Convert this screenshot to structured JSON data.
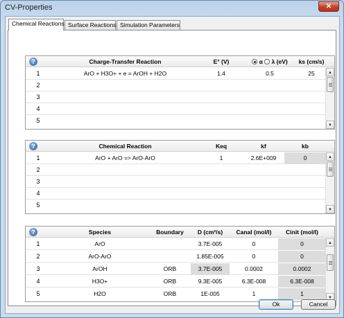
{
  "window": {
    "title": "CV-Properties",
    "close_glyph": "✕"
  },
  "tabs": [
    {
      "label": "Chemical Reactions",
      "active": true
    },
    {
      "label": "Surface Reactions",
      "active": false
    },
    {
      "label": "Simulation Parameters",
      "active": false
    }
  ],
  "charge_transfer": {
    "headers": {
      "reaction": "Charge-Transfer Reaction",
      "e0": "E° (V)",
      "alpha": "α",
      "lambda": "λ (eV)",
      "ks": "ks (cm/s)"
    },
    "selected_param": "alpha",
    "rows": [
      {
        "num": "1",
        "reaction": "ArO + H3O+ + e = ArOH + H2O",
        "e0": "1.4",
        "param": "0.5",
        "ks": "25"
      },
      {
        "num": "2",
        "reaction": "",
        "e0": "",
        "param": "",
        "ks": ""
      },
      {
        "num": "3",
        "reaction": "",
        "e0": "",
        "param": "",
        "ks": ""
      },
      {
        "num": "4",
        "reaction": "",
        "e0": "",
        "param": "",
        "ks": ""
      },
      {
        "num": "5",
        "reaction": "",
        "e0": "",
        "param": "",
        "ks": ""
      }
    ]
  },
  "chemical": {
    "headers": {
      "reaction": "Chemical Reaction",
      "keq": "Keq",
      "kf": "kf",
      "kb": "kb"
    },
    "rows": [
      {
        "num": "1",
        "reaction": "ArO + ArO => ArO-ArO",
        "keq": "1",
        "kf": "2.6E+009",
        "kb": "0"
      },
      {
        "num": "2",
        "reaction": "",
        "keq": "",
        "kf": "",
        "kb": ""
      },
      {
        "num": "3",
        "reaction": "",
        "keq": "",
        "kf": "",
        "kb": ""
      },
      {
        "num": "4",
        "reaction": "",
        "keq": "",
        "kf": "",
        "kb": ""
      },
      {
        "num": "5",
        "reaction": "",
        "keq": "",
        "kf": "",
        "kb": ""
      }
    ]
  },
  "species": {
    "headers": {
      "species": "Species",
      "boundary": "Boundary",
      "d": "D (cm²/s)",
      "canal": "Canal (mol/l)",
      "cinit": "Cinit (mol/l)"
    },
    "rows": [
      {
        "num": "1",
        "species": "ArO",
        "boundary": "",
        "d": "3.7E-005",
        "canal": "0",
        "cinit": "0"
      },
      {
        "num": "2",
        "species": "ArO-ArO",
        "boundary": "",
        "d": "1.85E-005",
        "canal": "0",
        "cinit": "0"
      },
      {
        "num": "3",
        "species": "ArOH",
        "boundary": "ORB",
        "d": "3.7E-005",
        "canal": "0.0002",
        "cinit": "0.0002"
      },
      {
        "num": "4",
        "species": "H3O+",
        "boundary": "ORB",
        "d": "9.3E-005",
        "canal": "6.3E-008",
        "cinit": "6.3E-008"
      },
      {
        "num": "5",
        "species": "H2O",
        "boundary": "ORB",
        "d": "1E-005",
        "canal": "1",
        "cinit": "1"
      }
    ]
  },
  "buttons": {
    "ok": "Ok",
    "cancel": "Cancel"
  },
  "help_glyph": "?",
  "icons": {
    "help": "help-icon",
    "scroll_up": "arrow-up-icon",
    "scroll_down": "arrow-down-icon",
    "close": "close-icon"
  }
}
